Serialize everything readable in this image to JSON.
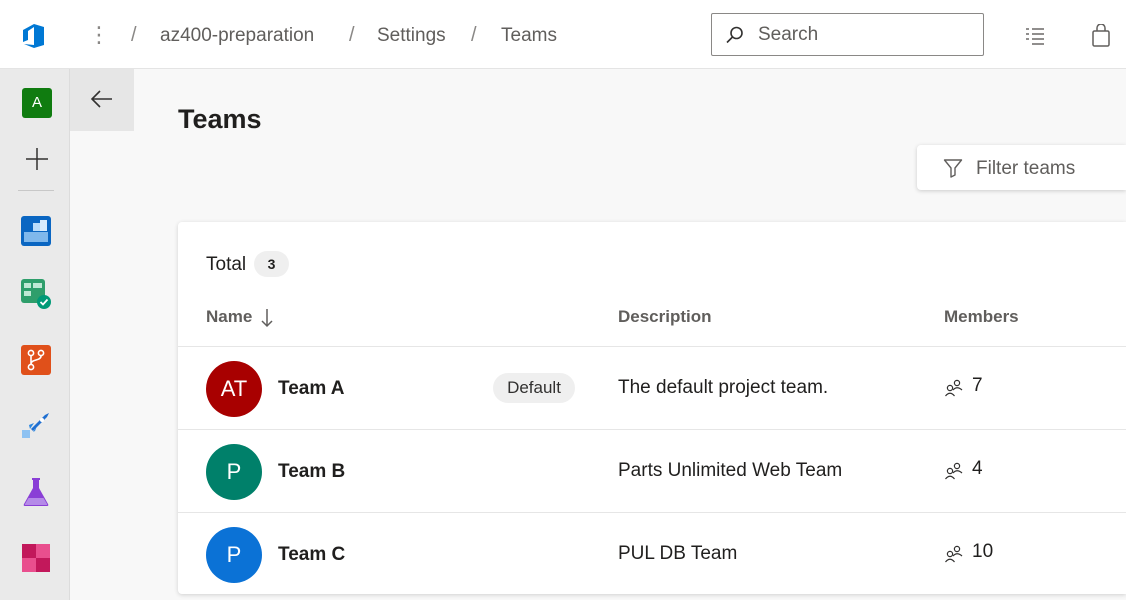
{
  "breadcrumb": {
    "project": "az400-preparation",
    "settings": "Settings",
    "current": "Teams"
  },
  "search": {
    "placeholder": "Search"
  },
  "rail": {
    "project_initial": "A"
  },
  "page": {
    "title": "Teams"
  },
  "filter": {
    "placeholder": "Filter teams"
  },
  "summary": {
    "total_label": "Total",
    "total_count": "3"
  },
  "columns": {
    "name": "Name",
    "description": "Description",
    "members": "Members"
  },
  "teams": [
    {
      "initials": "AT",
      "name": "Team A",
      "tag": "Default",
      "description": "The default project team.",
      "members": "7",
      "color": "#a80000"
    },
    {
      "initials": "P",
      "name": "Team B",
      "tag": "",
      "description": "Parts Unlimited Web Team",
      "members": "4",
      "color": "#00806a"
    },
    {
      "initials": "P",
      "name": "Team C",
      "tag": "",
      "description": "PUL DB Team",
      "members": "10",
      "color": "#0b72d6"
    }
  ],
  "colors": {
    "accent": "#0078d4",
    "project_avatar": "#107c10"
  }
}
